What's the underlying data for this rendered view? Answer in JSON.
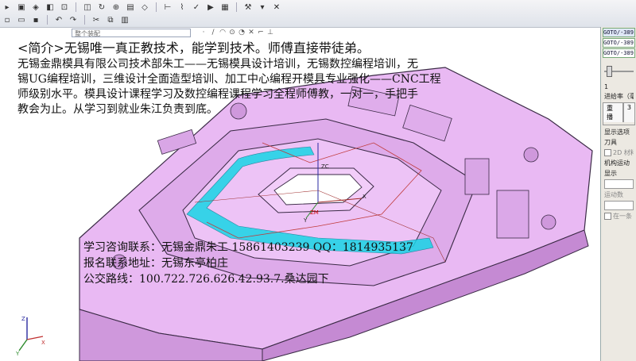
{
  "toolbar": {
    "row1_icons": [
      "select-icon",
      "filter-icon",
      "snap-icon",
      "render-icon",
      "view-icon",
      "fit-icon",
      "rotate-icon",
      "zoom-icon",
      "layer-icon",
      "analysis-icon",
      "measure-icon",
      "toolpath-icon",
      "verify-icon",
      "simulate-icon",
      "post-icon",
      "close-icon"
    ],
    "assembly_placeholder": "整个装配"
  },
  "right_panel": {
    "goto_lines": [
      "GOTO/-389",
      "GOTO/-389",
      "GOTO/-389"
    ],
    "slider_value": "1",
    "feed_label": "进给率（毫",
    "tabs": [
      "重播",
      "3"
    ],
    "display_options": "显示选项",
    "tool_label": "刀具",
    "tool_2d": "2D",
    "tool_material": "材料",
    "machine_motion": "机构运动",
    "display": "显示",
    "motion_display": "运动数",
    "checkbox_label": "在一条"
  },
  "overlay": {
    "intro_line": "<简介>无锡唯一真正教技术，能学到技术。师傅直接带徒弟。",
    "desc_line1": "无锡金鼎模具有限公司技术部朱工——无锡模具设计培训，无锡数控编程培训，无",
    "desc_line2": "锡UG编程培训，三维设计全面造型培训、加工中心编程开模具专业强化——CNC工程",
    "desc_line3": "师级别水平。模具设计课程学习及数控编程课程学习全程师傅教，一对一，手把手",
    "desc_line4": "教会为止。从学习到就业朱江负责到底。",
    "contact_line": "学习咨询联系：无锡金鼎朱工 15861403239 QQ：1814935137",
    "address_line": "报名联系地址：无锡东亭柏庄",
    "bus_line": "公交路线：100.722.726.626.42.93.7.桑达园下"
  },
  "model": {
    "body_color": "#e6b3f0",
    "edge_color": "#3a2a45",
    "toolpath_color": "#18d5e6",
    "axis_label_z": "ZC",
    "axis_label_x": "X",
    "axis_label_y": "Y",
    "origin_label": "ZM"
  }
}
